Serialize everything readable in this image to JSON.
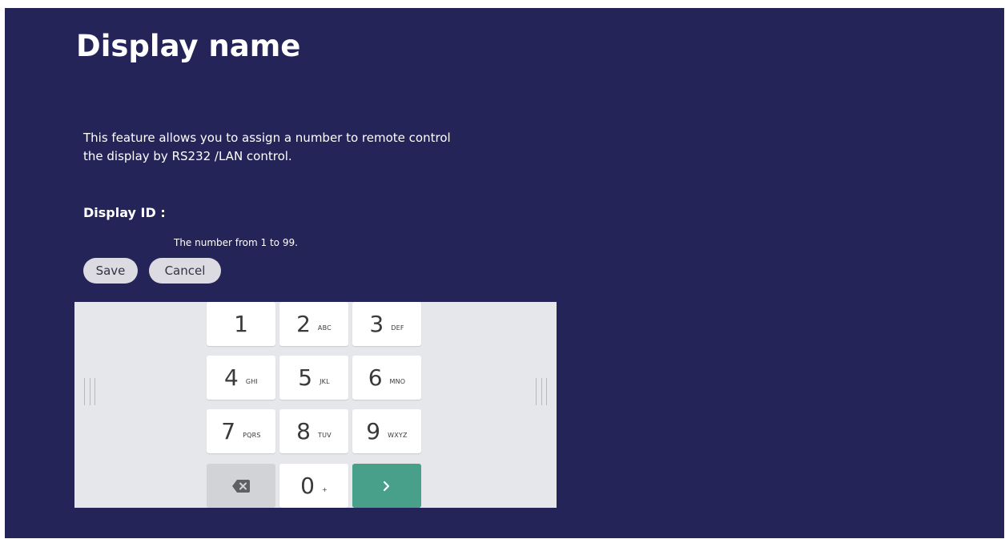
{
  "page": {
    "title": "Display name",
    "description": "This feature allows you to assign a number to remote control the display by RS232 /LAN control.",
    "display_id_label": "Display ID :",
    "hint": "The number from 1 to 99."
  },
  "buttons": {
    "save": "Save",
    "cancel": "Cancel"
  },
  "keypad": {
    "keys": [
      {
        "digit": "1",
        "letters": ""
      },
      {
        "digit": "2",
        "letters": "ABC"
      },
      {
        "digit": "3",
        "letters": "DEF"
      },
      {
        "digit": "4",
        "letters": "GHI"
      },
      {
        "digit": "5",
        "letters": "JKL"
      },
      {
        "digit": "6",
        "letters": "MNO"
      },
      {
        "digit": "7",
        "letters": "PQRS"
      },
      {
        "digit": "8",
        "letters": "TUV"
      },
      {
        "digit": "9",
        "letters": "WXYZ"
      },
      {
        "digit": "0",
        "letters": "+"
      }
    ],
    "backspace_icon": "backspace-icon",
    "enter_icon": "chevron-right-icon"
  },
  "colors": {
    "background": "#252459",
    "keyboard_background": "#e6e7ea",
    "enter_key": "#48a08a",
    "backspace_key": "#d2d3d6",
    "pill_button": "#dcdbe2"
  }
}
